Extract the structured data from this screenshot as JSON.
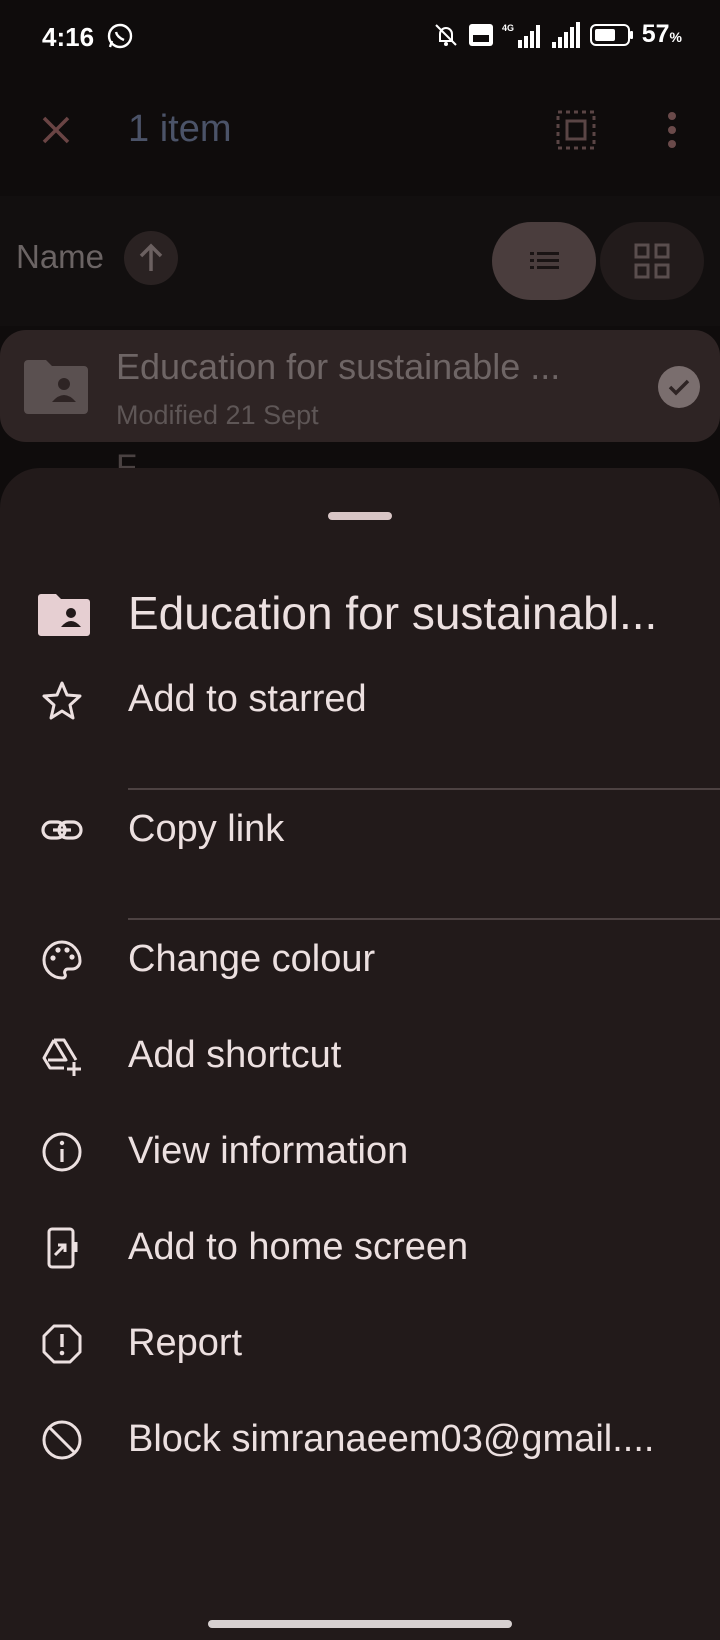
{
  "status_bar": {
    "time": "4:16",
    "battery": "57",
    "battery_unit": "%",
    "icons": [
      "whatsapp-icon",
      "mute-icon",
      "volte-icon",
      "signal-4g-icon",
      "signal-icon",
      "battery-icon"
    ]
  },
  "app_bar": {
    "title": "1 item",
    "close_icon": "close-icon",
    "select_all_icon": "select-all-icon",
    "more_icon": "more-vert-icon"
  },
  "sort_bar": {
    "sort_label": "Name",
    "sort_icon": "arrow-up-icon",
    "list_view_icon": "list-view-icon",
    "grid_view_icon": "grid-view-icon"
  },
  "selected_file": {
    "name": "Education for sustainable ...",
    "meta": "Modified 21 Sept",
    "icon": "shared-folder-icon",
    "checked": true
  },
  "peek_text": "F...",
  "sheet": {
    "title": "Education for sustainabl...",
    "title_icon": "shared-folder-icon",
    "items": [
      {
        "label": "Add to starred",
        "icon": "star-icon"
      },
      {
        "label": "Copy link",
        "icon": "link-icon"
      },
      {
        "label": "Change colour",
        "icon": "palette-icon"
      },
      {
        "label": "Add shortcut",
        "icon": "add-shortcut-icon"
      },
      {
        "label": "View information",
        "icon": "info-icon"
      },
      {
        "label": "Add to home screen",
        "icon": "add-home-screen-icon"
      },
      {
        "label": "Report",
        "icon": "report-icon"
      },
      {
        "label": "Block simranaeem03@gmail....",
        "icon": "block-icon"
      }
    ]
  },
  "colors": {
    "sheet_bg": "#221a1a",
    "sheet_text": "#ece0e0",
    "accent_dim": "#4b5368"
  }
}
